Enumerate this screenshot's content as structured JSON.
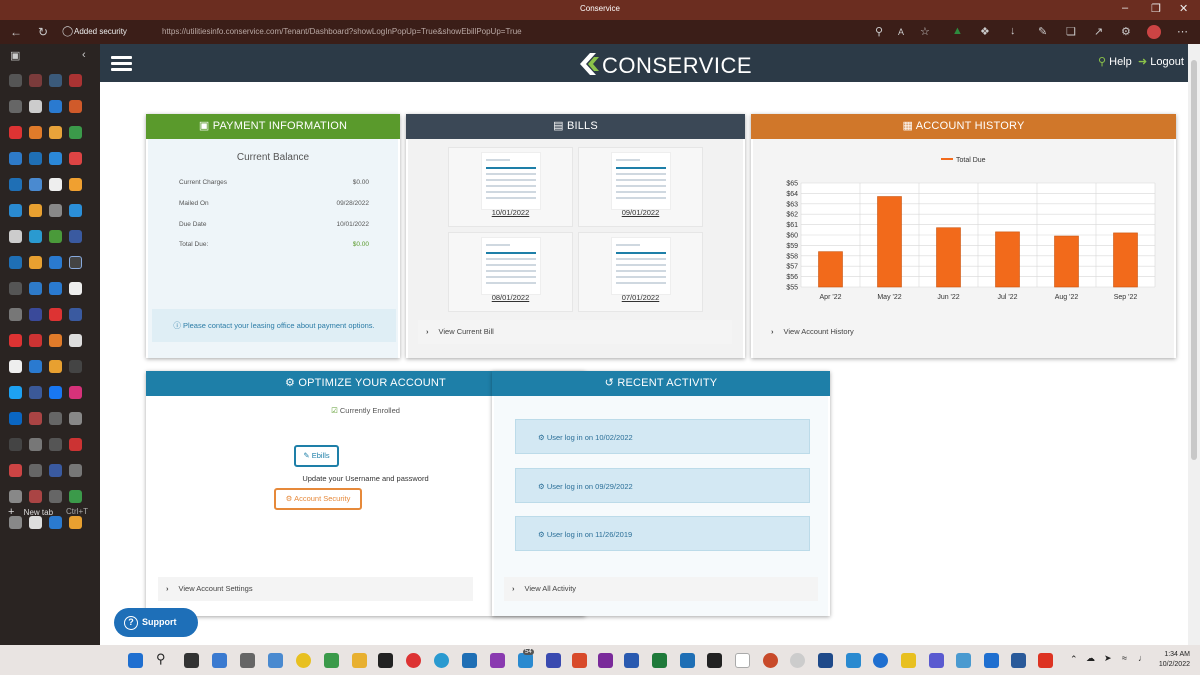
{
  "browser": {
    "window_title": "Conservice",
    "security_label": "Added security",
    "url": "https://utilitiesinfo.conservice.com/Tenant/Dashboard?showLogInPopUp=True&showEbillPopUp=True",
    "new_tab_label": "New tab",
    "new_tab_shortcut": "Ctrl+T"
  },
  "header": {
    "logo_text": "CONSERVICE",
    "help_label": "Help",
    "logout_label": "Logout"
  },
  "payment": {
    "title": "PAYMENT INFORMATION",
    "current_balance_label": "Current Balance",
    "rows": [
      {
        "label": "Current Charges",
        "value": "$0.00"
      },
      {
        "label": "Mailed On",
        "value": "09/28/2022"
      },
      {
        "label": "Due Date",
        "value": "10/01/2022"
      },
      {
        "label": "Total Due:",
        "value": "$0.00"
      }
    ],
    "notice": "Please contact your leasing office about payment options."
  },
  "bills": {
    "title": "BILLS",
    "items": [
      {
        "date": "10/01/2022"
      },
      {
        "date": "09/01/2022"
      },
      {
        "date": "08/01/2022"
      },
      {
        "date": "07/01/2022"
      }
    ],
    "view_link": "View Current Bill"
  },
  "history": {
    "title": "ACCOUNT HISTORY",
    "view_link": "View Account History"
  },
  "chart_data": {
    "type": "bar",
    "categories": [
      "Apr '22",
      "May '22",
      "Jun '22",
      "Jul '22",
      "Aug '22",
      "Sep '22"
    ],
    "series": [
      {
        "name": "Total Due",
        "values": [
          58.4,
          63.7,
          60.7,
          60.3,
          59.9,
          60.2
        ]
      }
    ],
    "yticks": [
      "$55",
      "$56",
      "$57",
      "$58",
      "$59",
      "$60",
      "$61",
      "$62",
      "$63",
      "$64",
      "$65"
    ],
    "ylim": [
      55,
      65
    ],
    "grid": true,
    "legend": "top",
    "color": "#f26a1b"
  },
  "optimize": {
    "title": "OPTIMIZE YOUR ACCOUNT",
    "enrolled_label": "Currently Enrolled",
    "ebills_label": "Ebills",
    "update_text": "Update your Username and password",
    "security_label": "Account Security",
    "view_link": "View Account Settings"
  },
  "activity": {
    "title": "RECENT ACTIVITY",
    "items": [
      {
        "text": "User log in on 10/02/2022"
      },
      {
        "text": "User log in on 09/29/2022"
      },
      {
        "text": "User log in on 11/26/2019"
      }
    ],
    "view_link": "View All Activity"
  },
  "support_label": "Support",
  "taskbar": {
    "badge_count": "54",
    "time": "1:34 AM",
    "date": "10/2/2022"
  },
  "colors": {
    "green": "#5a9a2c",
    "dark": "#3b4856",
    "orange": "#d0772a",
    "teal": "#1e7fa8",
    "brand_bar": "#2c3a47"
  }
}
